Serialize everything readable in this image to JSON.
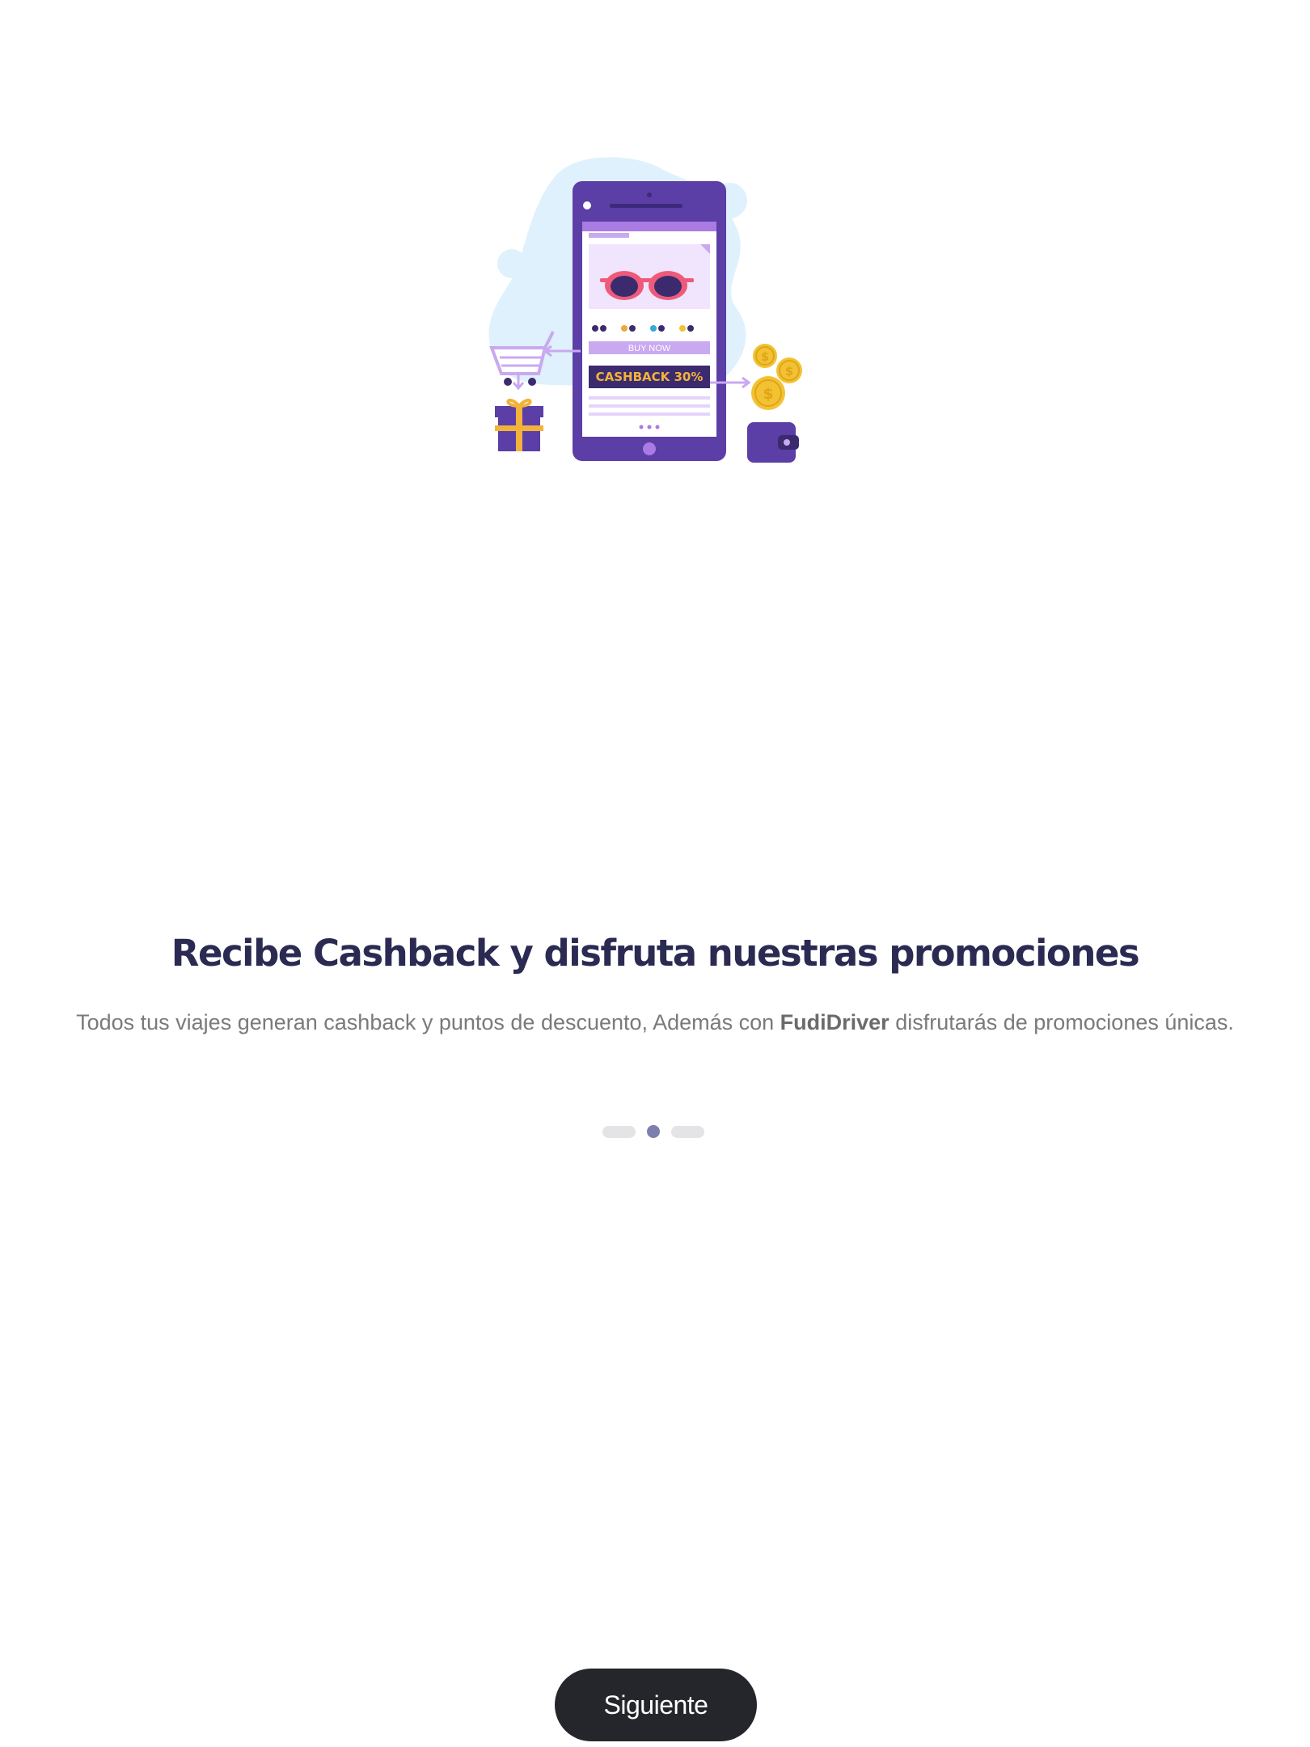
{
  "illustration": {
    "buy_now_label": "BUY NOW",
    "cashback_label": "CASHBACK 30%",
    "coin_symbol": "$"
  },
  "onboarding": {
    "title": "Recibe Cashback y disfruta nuestras promociones",
    "description_before": "Todos tus viajes generan cashback y puntos de descuento, Además con ",
    "description_brand": "FudiDriver",
    "description_after": " disfrutarás de promociones únicas.",
    "current_page": 2,
    "total_pages": 3
  },
  "actions": {
    "next_label": "Siguiente"
  },
  "colors": {
    "title": "#2b2a52",
    "text": "#7a7a7a",
    "accent": "#7d7fae",
    "button": "#25262b",
    "phone": "#5b3ea6"
  }
}
